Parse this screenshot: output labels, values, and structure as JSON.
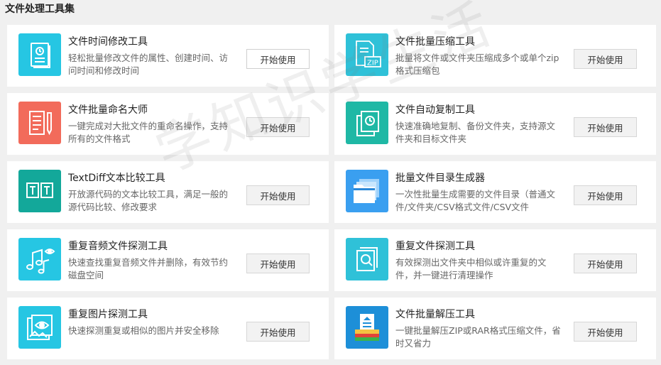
{
  "page": {
    "title": "文件处理工具集"
  },
  "watermark": "学知识学生活",
  "tools": [
    {
      "title": "文件时间修改工具",
      "desc": "轻松批量修改文件的属性、创建时间、访问时间和修改时间",
      "button": "开始使用",
      "icon": "document-clock-icon",
      "color": "#26c6e3"
    },
    {
      "title": "文件批量压缩工具",
      "desc": "批量将文件或文件夹压缩成多个或单个zip格式压缩包",
      "button": "开始使用",
      "icon": "zip-archive-icon",
      "color": "#2fc1d8"
    },
    {
      "title": "文件批量命名大师",
      "desc": "一键完成对大批文件的重命名操作，支持所有的文件格式",
      "button": "开始使用",
      "icon": "rename-document-pen-icon",
      "color": "#f26b5b"
    },
    {
      "title": "文件自动复制工具",
      "desc": "快速准确地复制、备份文件夹，支持源文件夹和目标文件夹",
      "button": "开始使用",
      "icon": "copy-document-clock-icon",
      "color": "#1fb8a5"
    },
    {
      "title": "TextDiff文本比较工具",
      "desc": "开放源代码的文本比较工具，满足一般的源代码比较、修改要求",
      "button": "开始使用",
      "icon": "text-compare-icon",
      "color": "#13a89a"
    },
    {
      "title": "批量文件目录生成器",
      "desc": "一次性批量生成需要的文件目录（普通文件/文件夹/CSV格式文件/CSV文件",
      "button": "开始使用",
      "icon": "folder-stack-icon",
      "color": "#3a9ff0"
    },
    {
      "title": "重复音频文件探测工具",
      "desc": "快速查找重复音频文件并删除，有效节约磁盘空间",
      "button": "开始使用",
      "icon": "music-notes-eye-icon",
      "color": "#26c6e3"
    },
    {
      "title": "重复文件探测工具",
      "desc": "有效探测出文件夹中相似或许重复的文件，并一键进行清理操作",
      "button": "开始使用",
      "icon": "document-search-icon",
      "color": "#2fc1d8"
    },
    {
      "title": "重复图片探测工具",
      "desc": "快速探测重复或相似的图片并安全移除",
      "button": "开始使用",
      "icon": "image-eye-icon",
      "color": "#26c6e3"
    },
    {
      "title": "文件批量解压工具",
      "desc": "一键批量解压ZIP或RAR格式压缩文件，省时又省力",
      "button": "开始使用",
      "icon": "unzip-tray-icon",
      "color": "#1d8fd8"
    }
  ]
}
